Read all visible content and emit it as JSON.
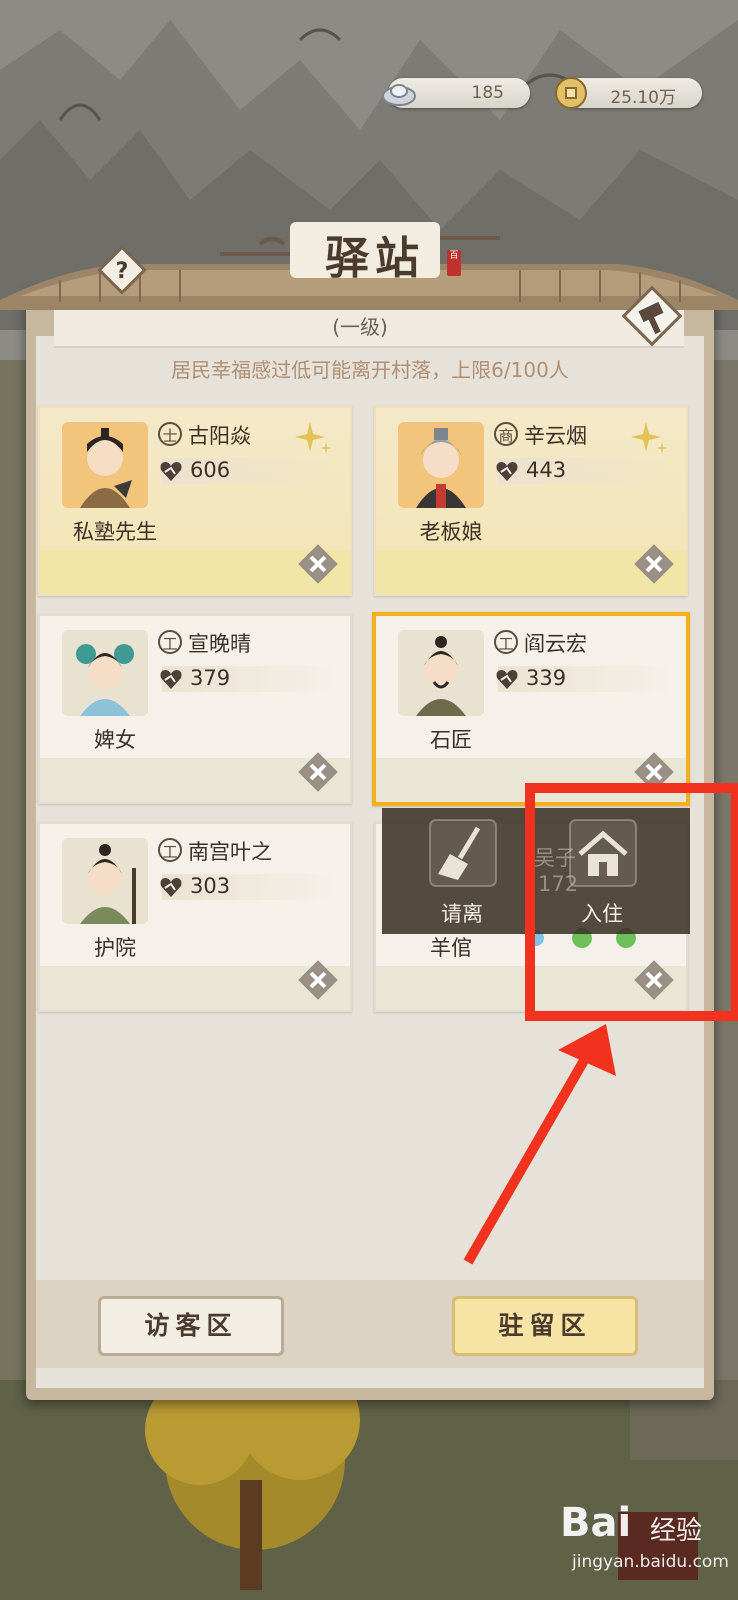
{
  "currencies": [
    {
      "name": "silver-ingot",
      "amount": "185"
    },
    {
      "name": "copper-coin",
      "amount": "25.10万"
    }
  ],
  "panel": {
    "title": "驿站",
    "title_seal": "百",
    "level": "(一级)",
    "notice": "居民幸福感过低可能离开村落，上限6/100人"
  },
  "residents": [
    {
      "role": "私塾先生",
      "class_icon": "士",
      "name": "古阳焱",
      "value": "606",
      "tier": "gold"
    },
    {
      "role": "老板娘",
      "class_icon": "商",
      "name": "辛云烟",
      "value": "443",
      "tier": "gold"
    },
    {
      "role": "婢女",
      "class_icon": "工",
      "name": "宣晚晴",
      "value": "379",
      "tier": "normal"
    },
    {
      "role": "石匠",
      "class_icon": "工",
      "name": "阎云宏",
      "value": "339",
      "tier": "selected"
    },
    {
      "role": "护院",
      "class_icon": "工",
      "name": "南宫叶之",
      "value": "303",
      "tier": "normal"
    },
    {
      "role": "羊倌",
      "class_icon": "",
      "name": "吴子",
      "value": "172",
      "tier": "covered"
    }
  ],
  "overlay": {
    "dismiss_label": "请离",
    "move_in_label": "入住"
  },
  "bottom": {
    "visitor_label": "访客区",
    "resident_label": "驻留区"
  },
  "watermark": {
    "logo": "Bai",
    "logo_suffix": "经验",
    "url": "jingyan.baidu.com"
  },
  "colors": {
    "highlight_box": "#f0321e",
    "selected_border": "#f2b01e"
  }
}
